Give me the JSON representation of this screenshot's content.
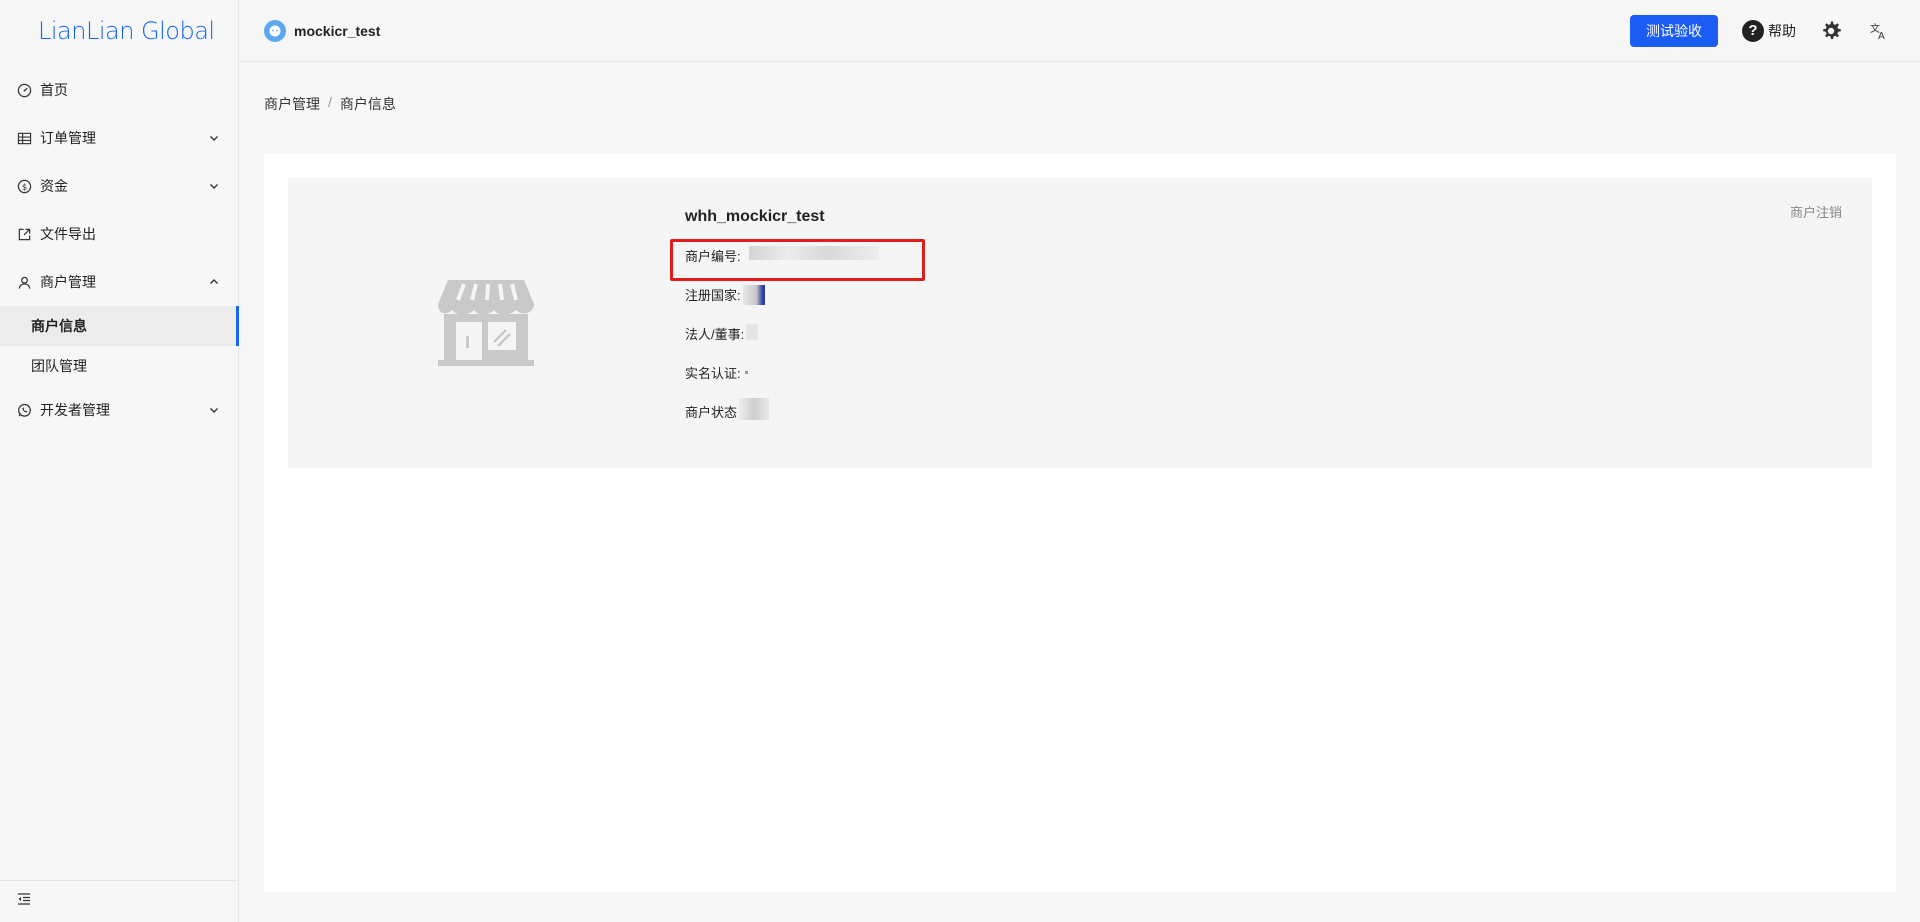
{
  "brand": {
    "logo": "LianLian Global",
    "accent": "#1565f0"
  },
  "sidebar": {
    "items": [
      {
        "label": "首页",
        "icon": "dashboard-icon"
      },
      {
        "label": "订单管理",
        "icon": "table-icon"
      },
      {
        "label": "资金",
        "icon": "dollar-icon"
      },
      {
        "label": "文件导出",
        "icon": "export-icon"
      },
      {
        "label": "商户管理",
        "icon": "user-icon"
      },
      {
        "label": "开发者管理",
        "icon": "whatsapp-icon"
      }
    ],
    "merchant_sub": [
      {
        "label": "商户信息",
        "active": true
      },
      {
        "label": "团队管理",
        "active": false
      }
    ]
  },
  "header": {
    "account_name": "mockicr_test",
    "primary_button": "测试验收",
    "help_label": "帮助"
  },
  "breadcrumb": {
    "level1": "商户管理",
    "separator": "/",
    "level2": "商户信息"
  },
  "profile": {
    "name": "whh_mockicr_test",
    "fields": {
      "merchant_id_label": "商户编号:",
      "country_label": "注册国家:",
      "legal_label": "法人/董事:",
      "verification_label": "实名认证:",
      "status_label": "商户状态"
    },
    "cancel_link": "商户注销"
  }
}
